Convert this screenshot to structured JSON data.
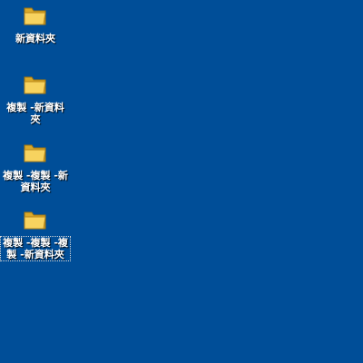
{
  "desktop": {
    "background_color": "#004e98",
    "icons": [
      {
        "label": "新資料夾",
        "icon": "folder-icon",
        "selected": false
      },
      {
        "label": "複製 -新資料夾",
        "icon": "folder-icon",
        "selected": false
      },
      {
        "label": "複製 -複製 -新資料夾",
        "icon": "folder-icon",
        "selected": false
      },
      {
        "label": "複製 -複製 -複製 -新資料夾",
        "icon": "folder-icon",
        "selected": true
      }
    ]
  }
}
